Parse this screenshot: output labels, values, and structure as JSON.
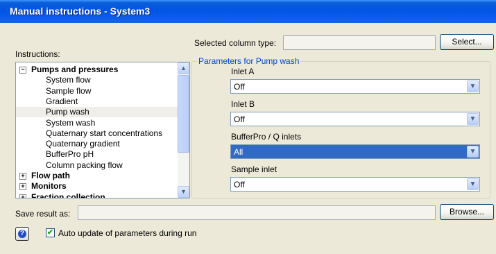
{
  "window": {
    "title": "Manual instructions - System3"
  },
  "column": {
    "label": "Selected column type:",
    "value": "",
    "select_button": "Select..."
  },
  "instructions": {
    "label": "Instructions:",
    "tree": [
      {
        "label": "Pumps and pressures",
        "bold": true,
        "expander": "−"
      },
      {
        "label": "System flow"
      },
      {
        "label": "Sample flow"
      },
      {
        "label": "Gradient"
      },
      {
        "label": "Pump wash",
        "selected": true
      },
      {
        "label": "System wash"
      },
      {
        "label": "Quaternary start concentrations"
      },
      {
        "label": "Quaternary gradient"
      },
      {
        "label": "BufferPro pH"
      },
      {
        "label": "Column packing flow"
      },
      {
        "label": "Flow path",
        "bold": true,
        "expander": "+"
      },
      {
        "label": "Monitors",
        "bold": true,
        "expander": "+"
      },
      {
        "label": "Fraction collection",
        "bold": true,
        "expander": "+"
      }
    ],
    "scroll_up": "▲",
    "scroll_down": "▼"
  },
  "parameters": {
    "legend": "Parameters for Pump wash",
    "fields": [
      {
        "label": "Inlet A",
        "value": "Off"
      },
      {
        "label": "Inlet B",
        "value": "Off"
      },
      {
        "label": "BufferPro / Q inlets",
        "value": "All",
        "active": true
      },
      {
        "label": "Sample inlet",
        "value": "Off"
      }
    ],
    "dropdown_glyph": "▼"
  },
  "save": {
    "label": "Save result as:",
    "value": "",
    "browse_button": "Browse..."
  },
  "auto_update": {
    "label": "Auto update of parameters during run",
    "checked": true,
    "check_glyph": "✔"
  },
  "help": {
    "glyph": "?"
  }
}
